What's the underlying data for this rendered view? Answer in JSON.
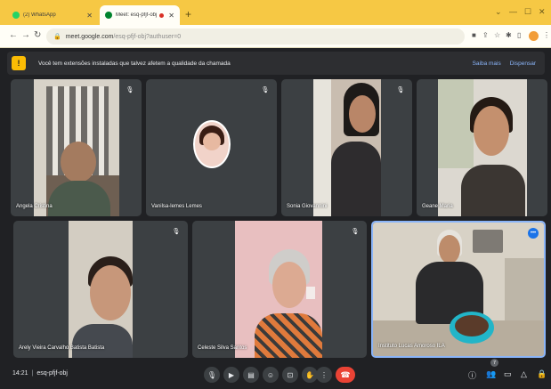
{
  "browser": {
    "tabs": [
      {
        "title": "(2) WhatsApp",
        "icon": "whatsapp-icon"
      },
      {
        "title": "Meet: esq-pfjf-obj",
        "icon": "meet-icon"
      }
    ],
    "url": {
      "domain": "meet.google.com",
      "path": "/esq-pfjf-obj?authuser=0"
    }
  },
  "banner": {
    "text": "Você tem extensões instaladas que talvez afetem a qualidade da chamada",
    "learn_more": "Saiba mais",
    "dismiss": "Dispensar"
  },
  "participants": [
    {
      "name": "Angela Cristina",
      "muted": true
    },
    {
      "name": "Vanilsa-lemes Lemes",
      "muted": true
    },
    {
      "name": "Sonia Giovannini",
      "muted": true
    },
    {
      "name": "Geane Maria",
      "muted": false
    },
    {
      "name": "Arely Vieira Carvalho Batista Batista",
      "muted": true
    },
    {
      "name": "Celeste Silva Santos",
      "muted": true
    },
    {
      "name": "Instituto Lucas Amoroso ILA",
      "muted": false,
      "speaking": true
    }
  ],
  "meeting": {
    "time": "14:21",
    "code": "esq-pfjf-obj",
    "participant_count": "7"
  },
  "colors": {
    "tab_bar": "#f6c844",
    "meet_bg": "#202124",
    "tile_bg": "#3c4043",
    "end_call": "#ea4335",
    "speaking_border": "#8ab4f8"
  }
}
